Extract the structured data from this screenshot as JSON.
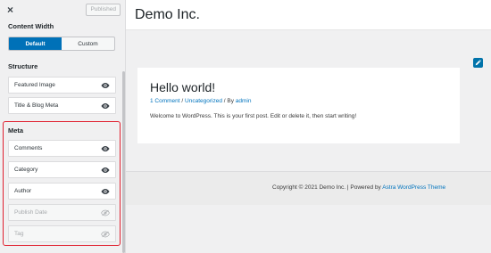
{
  "sidebar": {
    "close_label": "×",
    "publish_label": "Published",
    "content_width": {
      "title": "Content Width",
      "options": [
        "Default",
        "Custom"
      ],
      "selected": "Default"
    },
    "structure": {
      "title": "Structure",
      "items": [
        {
          "label": "Featured Image",
          "visible": true
        },
        {
          "label": "Title & Blog Meta",
          "visible": true
        }
      ]
    },
    "meta": {
      "title": "Meta",
      "items": [
        {
          "label": "Comments",
          "visible": true
        },
        {
          "label": "Category",
          "visible": true
        },
        {
          "label": "Author",
          "visible": true
        },
        {
          "label": "Publish Date",
          "visible": false
        },
        {
          "label": "Tag",
          "visible": false
        }
      ]
    }
  },
  "preview": {
    "site_title": "Demo Inc.",
    "post": {
      "title": "Hello world!",
      "meta_comments": "1 Comment",
      "meta_sep": " / ",
      "meta_category": "Uncategorized",
      "meta_by": " / By ",
      "meta_author": "admin",
      "excerpt": "Welcome to WordPress. This is your first post. Edit or delete it, then start writing!"
    },
    "footer": {
      "text": "Copyright © 2021 Demo Inc. | Powered by ",
      "link": "Astra WordPress Theme"
    }
  },
  "colors": {
    "accent": "#0071b8",
    "link": "#0274be",
    "highlight_border": "#e0202f"
  },
  "icons": {
    "close": "close-icon",
    "visible": "eye-icon",
    "hidden": "eye-slash-icon",
    "edit": "pencil-icon"
  }
}
